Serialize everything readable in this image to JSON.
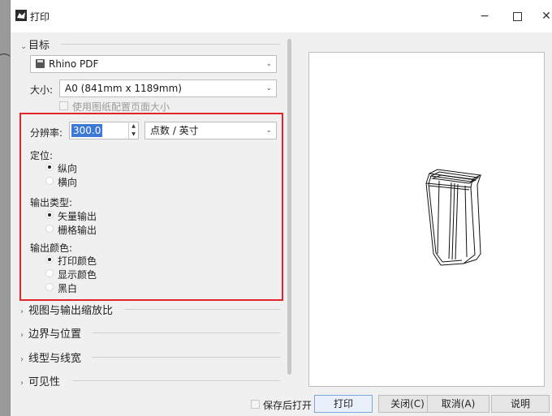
{
  "window": {
    "title": "打印",
    "minimize_glyph": "−",
    "close_glyph": "✕"
  },
  "sections": {
    "target": {
      "label": "目标",
      "collapsed": false
    },
    "view_scale": {
      "label": "视图与输出缩放比"
    },
    "margins": {
      "label": "边界与位置"
    },
    "linetypes": {
      "label": "线型与线宽"
    },
    "visibility": {
      "label": "可见性"
    }
  },
  "destination": {
    "value": "Rhino PDF"
  },
  "size": {
    "label": "大小:",
    "value": "A0 (841mm x 1189mm)"
  },
  "use_layout_size": {
    "label": "使用图纸配置页面大小",
    "checked": false,
    "disabled": true
  },
  "resolution": {
    "label": "分辨率:",
    "value": "300.0",
    "unit": "点数 / 英寸"
  },
  "orientation": {
    "label": "定位:",
    "options": [
      {
        "label": "纵向",
        "selected": true
      },
      {
        "label": "横向",
        "selected": false
      }
    ]
  },
  "output_type": {
    "label": "输出类型:",
    "options": [
      {
        "label": "矢量输出",
        "selected": true
      },
      {
        "label": "栅格输出",
        "selected": false
      }
    ]
  },
  "output_color": {
    "label": "输出颜色:",
    "options": [
      {
        "label": "打印颜色",
        "selected": true
      },
      {
        "label": "显示颜色",
        "selected": false
      },
      {
        "label": "黑白",
        "selected": false
      }
    ]
  },
  "footer": {
    "open_after_save": {
      "label": "保存后打开",
      "checked": false
    },
    "print_button": "打印",
    "close_button": "关闭(C)",
    "cancel_button": "取消(A)",
    "help_button": "说明"
  },
  "colors": {
    "highlight_box": "#e0242a",
    "selection": "#3b78d8"
  }
}
